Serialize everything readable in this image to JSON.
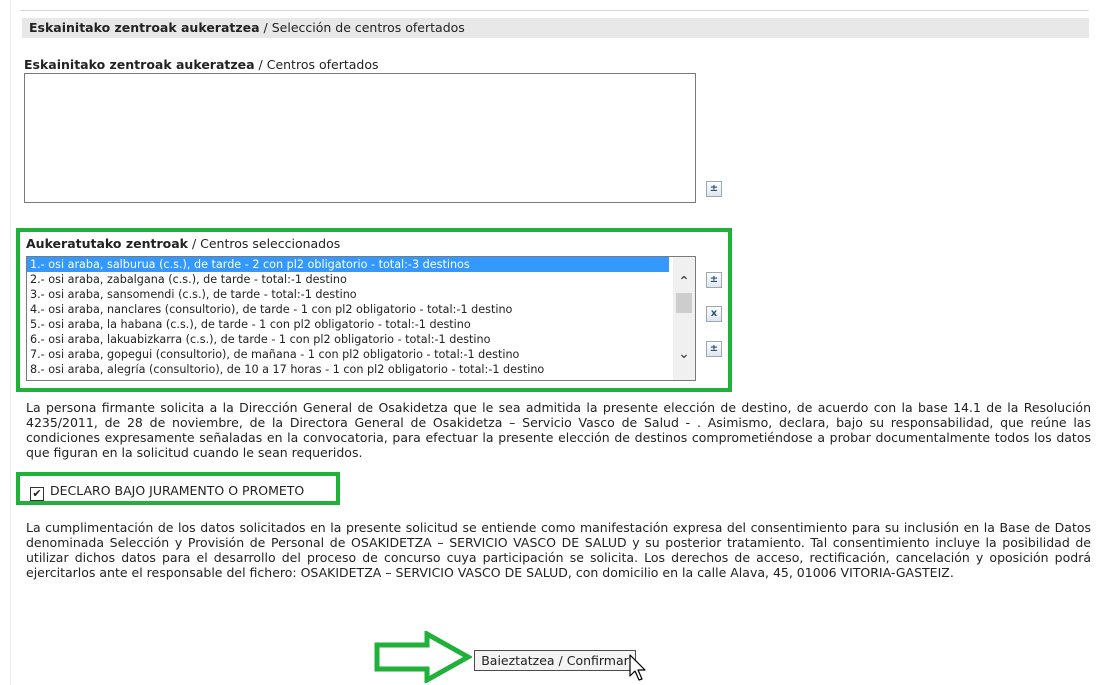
{
  "header": {
    "title_eu": "Eskainitako zentroak aukeratzea",
    "title_es": " / Selección de centros ofertados"
  },
  "offered": {
    "label_eu": "Eskainitako zentroak aukeratzea",
    "label_es": " / Centros ofertados",
    "add_button": "±"
  },
  "selected": {
    "label_eu": "Aukeratutako zentroak",
    "label_es": " / Centros seleccionados",
    "items": [
      "1.- osi araba, salburua (c.s.), de tarde - 2 con pl2 obligatorio - total:-3 destinos",
      "2.- osi araba, zabalgana (c.s.), de tarde - total:-1 destino",
      "3.- osi araba, sansomendi (c.s.), de tarde - total:-1 destino",
      "4.- osi araba, nanclares (consultorio), de tarde - 1 con pl2 obligatorio - total:-1 destino",
      "5.- osi araba, la habana (c.s.), de tarde - 1 con pl2 obligatorio - total:-1 destino",
      "6.- osi araba, lakuabizkarra (c.s.), de tarde - 1 con pl2 obligatorio - total:-1 destino",
      "7.- osi araba, gopegui (consultorio), de mañana - 1 con pl2 obligatorio - total:-1 destino",
      "8.- osi araba, alegría (consultorio), de 10 a 17 horas - 1 con pl2 obligatorio - total:-1 destino"
    ],
    "up_button": "±",
    "remove_button": "x",
    "down_button": "±"
  },
  "declaration": {
    "text": "La persona firmante solicita a la Dirección General de Osakidetza que le sea admitida la presente elección de destino, de acuerdo con la base 14.1 de la Resolución 4235/2011, de 28 de noviembre, de la Directora General de Osakidetza – Servicio Vasco de Salud - . Asimismo, declara, bajo su responsabilidad, que reúne las condiciones expresamente señaladas en la convocatoria, para efectuar la presente elección de destinos comprometiéndose a probar documentalmente todos los datos que figuran en la solicitud cuando le sean requeridos.",
    "checkbox_label": "DECLARO BAJO JURAMENTO O PROMETO",
    "checked": true
  },
  "consent": {
    "text": "La cumplimentación de los datos solicitados en la presente solicitud se entiende como manifestación expresa del consentimiento para su inclusión en la Base de Datos denominada Selección y Provisión de Personal de OSAKIDETZA – SERVICIO VASCO DE SALUD y su posterior tratamiento. Tal consentimiento incluye la posibilidad de utilizar dichos datos para el desarrollo del proceso de concurso cuya participación se solicita. Los derechos de acceso, rectificación, cancelación y oposición podrá ejercitarlos ante el responsable del fichero: OSAKIDETZA – SERVICIO VASCO DE SALUD, con domicilio en la calle Alava, 45, 01006 VITORIA-GASTEIZ."
  },
  "confirm": {
    "label": "Baieztatzea / Confirmar"
  },
  "colors": {
    "highlight_green": "#1fb13a",
    "selection_blue": "#3399ff",
    "header_gray": "#e8e8e8"
  }
}
